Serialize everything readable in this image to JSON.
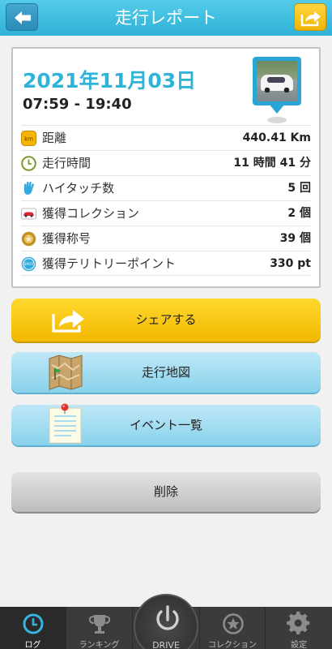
{
  "header": {
    "title": "走行レポート"
  },
  "report": {
    "date": "2021年11月03日",
    "time_range": "07:59 - 19:40",
    "stats": [
      {
        "icon": "km-icon",
        "badge": "km",
        "label": "距離",
        "value": "440.41 Km"
      },
      {
        "icon": "clock-icon",
        "label": "走行時間",
        "value": "11 時間 41 分"
      },
      {
        "icon": "hand-icon",
        "label": "ハイタッチ数",
        "value": "5 回"
      },
      {
        "icon": "car-collection-icon",
        "label": "獲得コレクション",
        "value": "2 個"
      },
      {
        "icon": "medal-icon",
        "label": "獲得称号",
        "value": "39 個"
      },
      {
        "icon": "spot-icon",
        "badge": "SPOT",
        "label": "獲得テリトリーポイント",
        "value": "330 pt"
      }
    ]
  },
  "buttons": {
    "share": "シェアする",
    "map": "走行地図",
    "events": "イベント一覧",
    "delete": "削除"
  },
  "nav": {
    "tabs": [
      {
        "label": "ログ",
        "icon": "clock-icon",
        "active": true
      },
      {
        "label": "ランキング",
        "icon": "trophy-icon",
        "active": false
      },
      {
        "label": "コレクション",
        "icon": "star-icon",
        "active": false
      },
      {
        "label": "設定",
        "icon": "gear-icon",
        "active": false
      }
    ],
    "drive": "DRIVE"
  },
  "colors": {
    "header": "#2fb2d8",
    "accent": "#2fb3d9",
    "share_button": "#f2b800",
    "nav": "#3b3b3b"
  }
}
